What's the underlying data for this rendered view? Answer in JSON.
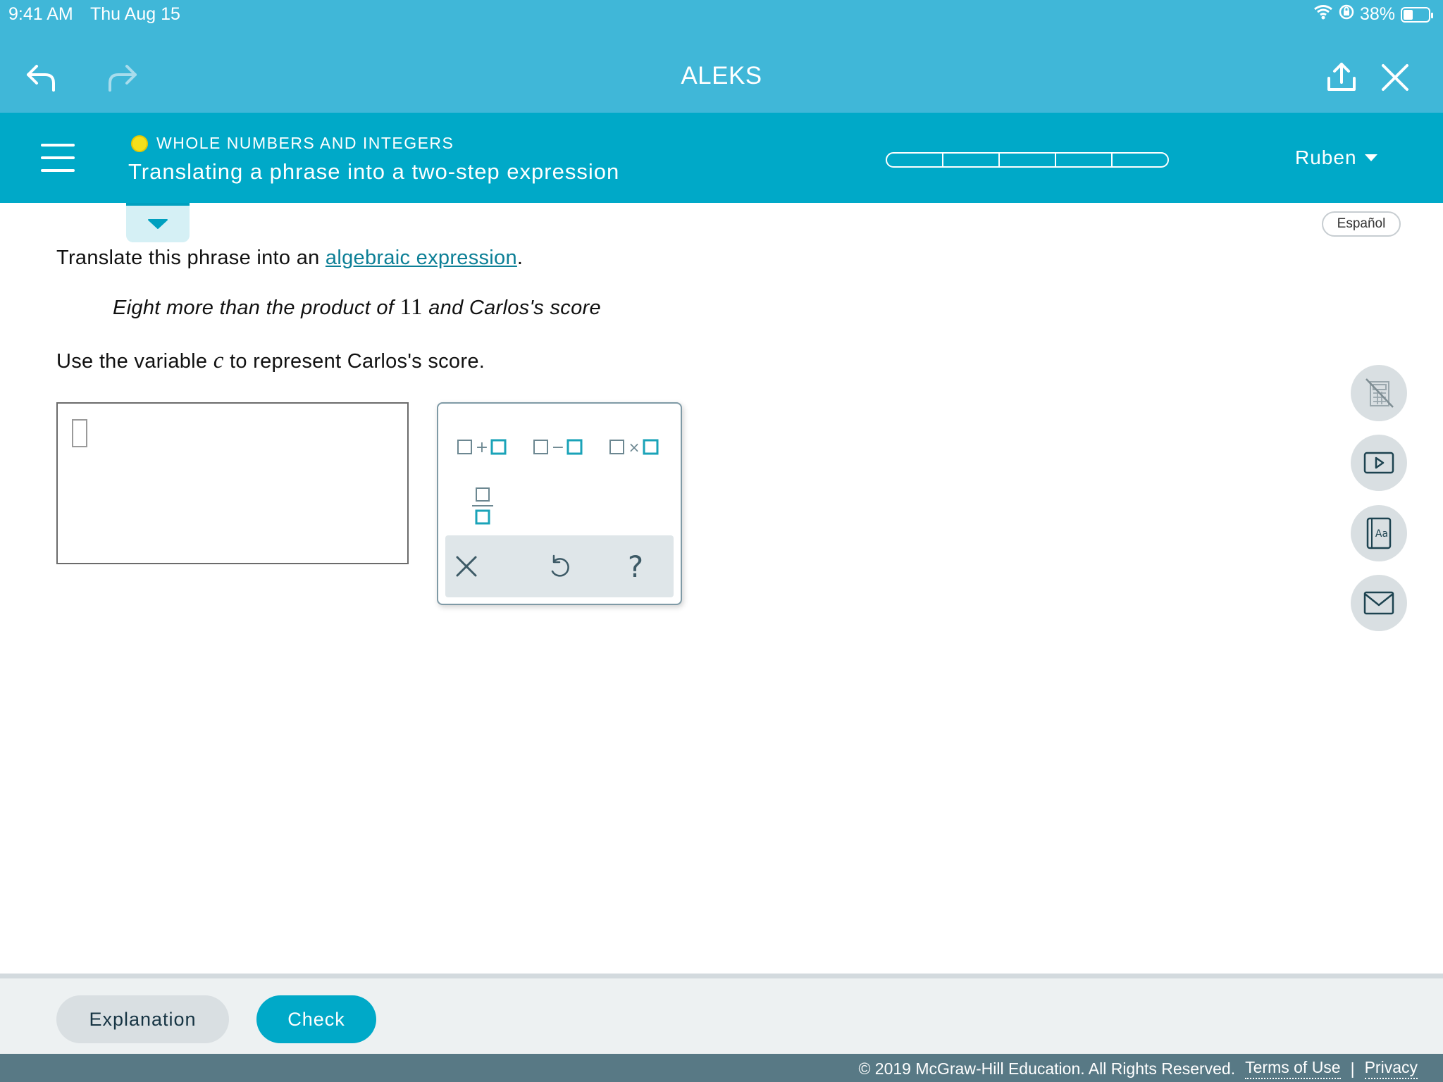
{
  "status_bar": {
    "time": "9:41 AM",
    "date": "Thu Aug 15",
    "battery": "38%",
    "battery_level": 0.38
  },
  "app_bar": {
    "title": "ALEKS"
  },
  "topic": {
    "category": "WHOLE NUMBERS AND INTEGERS",
    "title": "Translating a phrase into a two-step expression",
    "status_color": "#f4e01b",
    "progress_segments": 5,
    "progress_filled": 0
  },
  "user": {
    "name": "Ruben"
  },
  "language_button": "Español",
  "question": {
    "prompt_prefix": "Translate this phrase into an ",
    "prompt_link": "algebraic expression",
    "prompt_suffix": ".",
    "phrase_before": "Eight more than the product of ",
    "phrase_number": "11",
    "phrase_after": " and Carlos's score",
    "instruction_before": "Use the variable ",
    "instruction_variable": "c",
    "instruction_after": " to represent Carlos's score."
  },
  "answer": {
    "value": ""
  },
  "keypad": {
    "keys": [
      {
        "name": "addition",
        "symbol": "+"
      },
      {
        "name": "subtraction",
        "symbol": "−"
      },
      {
        "name": "multiplication",
        "symbol": "×"
      },
      {
        "name": "fraction",
        "symbol": ""
      }
    ],
    "actions": [
      "clear",
      "undo",
      "help"
    ],
    "help_symbol": "?"
  },
  "side_tools": [
    "calculator-disabled-icon",
    "video-icon",
    "dictionary-icon",
    "mail-icon"
  ],
  "buttons": {
    "explanation": "Explanation",
    "check": "Check"
  },
  "footer": {
    "copyright": "© 2019 McGraw-Hill Education. All Rights Reserved.",
    "terms": "Terms of Use",
    "separator": "|",
    "privacy": "Privacy"
  },
  "colors": {
    "top_bar": "#40b7d8",
    "topic_bar": "#00a9c8",
    "link": "#0c7f96",
    "footer": "#587985",
    "accent_box": "#1aa3b8"
  }
}
